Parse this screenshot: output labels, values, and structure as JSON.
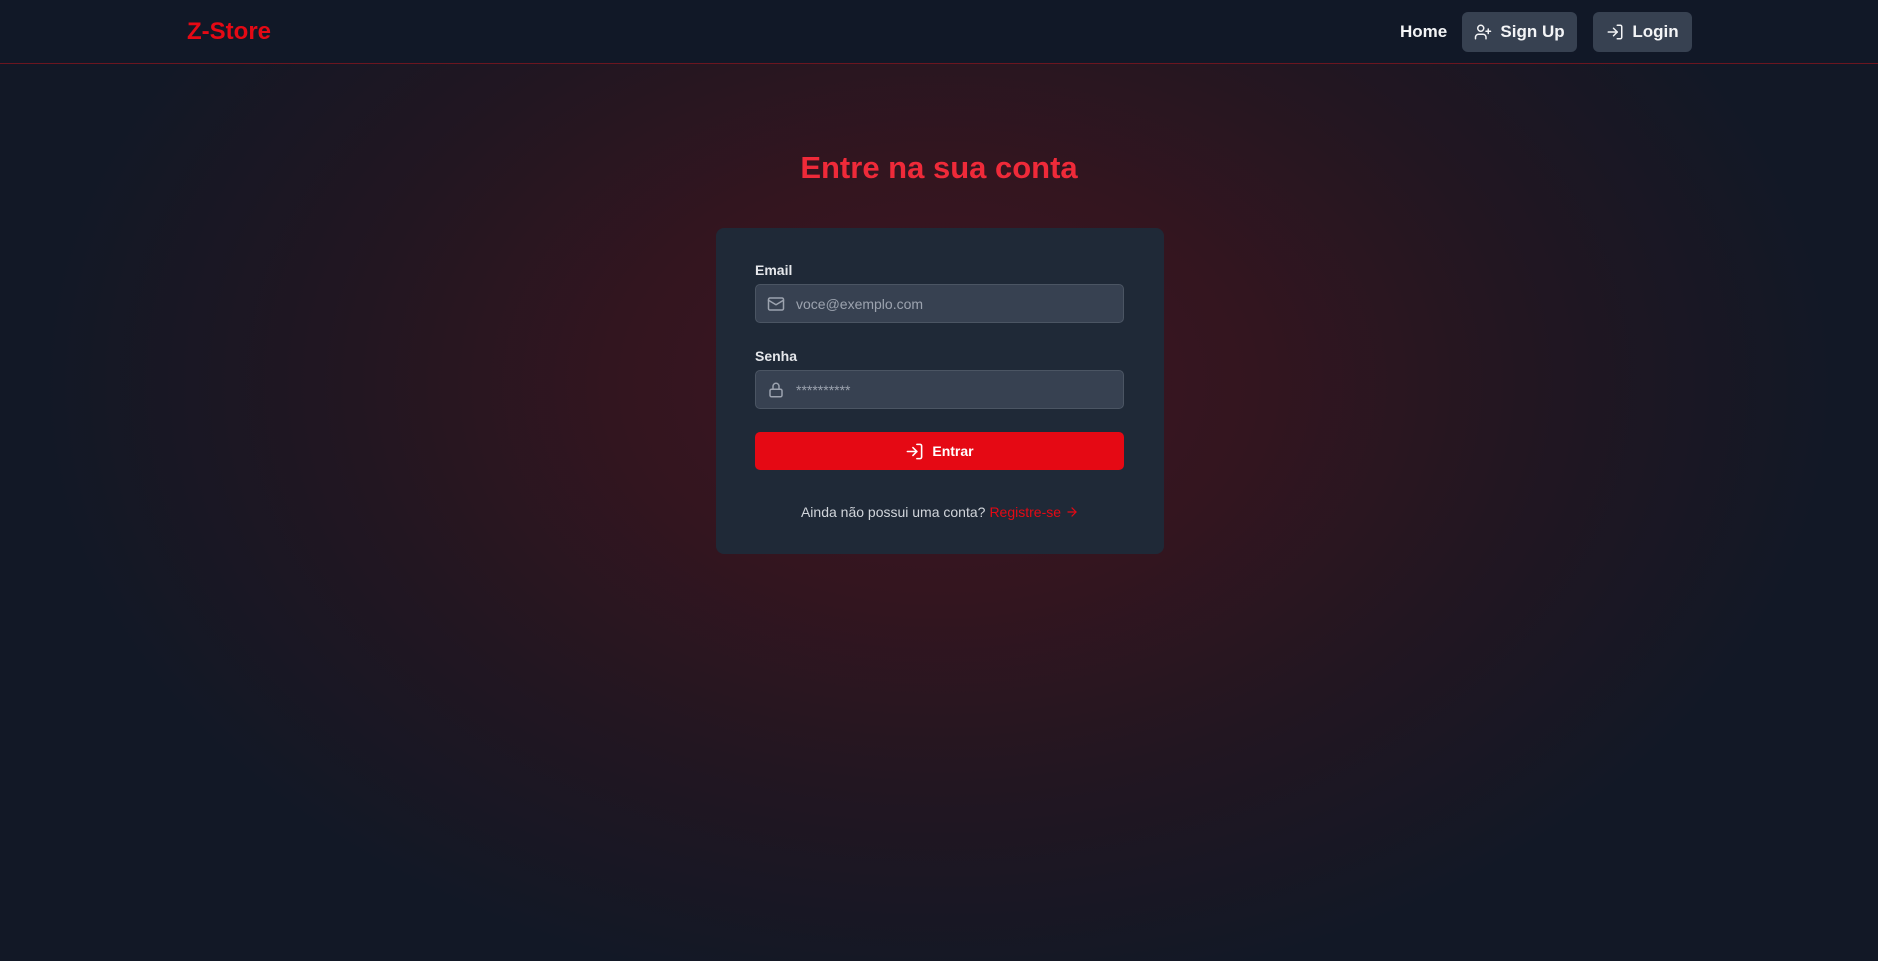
{
  "navbar": {
    "brand": "Z-Store",
    "home": "Home",
    "signup": {
      "label": "Sign Up",
      "icon": "user-plus-icon"
    },
    "login": {
      "label": "Login",
      "icon": "log-in-icon"
    }
  },
  "main": {
    "title": "Entre na sua conta"
  },
  "form": {
    "email_label": "Email",
    "email_placeholder": "voce@exemplo.com",
    "email_icon": "mail-icon",
    "password_label": "Senha",
    "password_placeholder": "**********",
    "password_icon": "lock-icon",
    "submit_label": "Entrar",
    "submit_icon": "log-in-icon",
    "register_question": "Ainda não possui uma conta?",
    "register_link": "Registre-se",
    "register_icon": "arrow-right-icon"
  },
  "colors": {
    "accent": "#e50914",
    "title": "#ef2a39",
    "navbar_bg": "#111827",
    "card_bg": "#1f2937",
    "input_bg": "#374151"
  }
}
